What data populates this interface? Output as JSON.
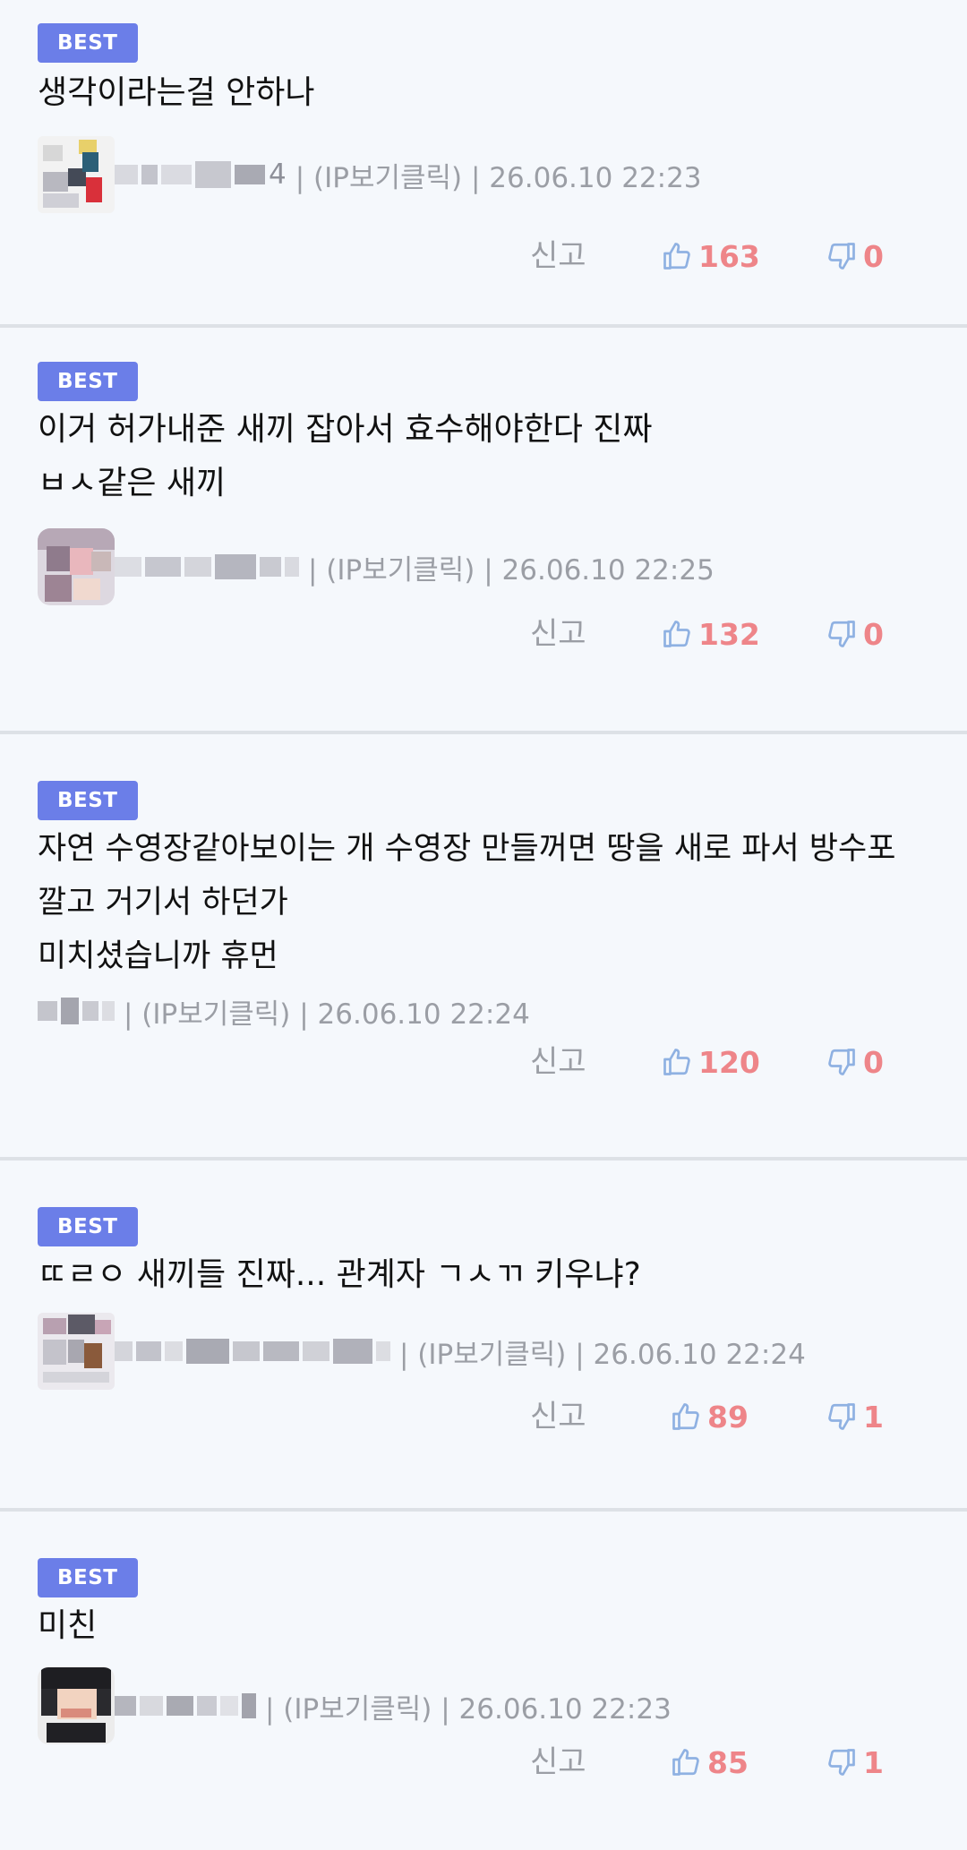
{
  "comments": [
    {
      "badge": "BEST",
      "content": "생각이라는걸 안하나",
      "nick_tail": "4",
      "meta": "| (IP보기클릭) | 26.06.10 22:23",
      "report_label": "신고",
      "likes": "163",
      "dislikes": "0"
    },
    {
      "badge": "BEST",
      "content": "이거 허가내준 새끼 잡아서 효수해야한다 진짜\nㅂㅅ같은 새끼",
      "nick_tail": "",
      "meta": "| (IP보기클릭) | 26.06.10 22:25",
      "report_label": "신고",
      "likes": "132",
      "dislikes": "0"
    },
    {
      "badge": "BEST",
      "content": "자연 수영장같아보이는 개 수영장 만들꺼면 땅을 새로 파서 방수포 깔고 거기서 하던가\n미치셨습니까 휴먼",
      "nick_tail": "",
      "meta": "| (IP보기클릭) | 26.06.10 22:24",
      "report_label": "신고",
      "likes": "120",
      "dislikes": "0"
    },
    {
      "badge": "BEST",
      "content": "ㄸㄹㅇ 새끼들 진짜... 관계자 ㄱㅅㄲ 키우냐?",
      "nick_tail": "",
      "meta": "| (IP보기클릭) | 26.06.10 22:24",
      "report_label": "신고",
      "likes": "89",
      "dislikes": "1"
    },
    {
      "badge": "BEST",
      "content": "미친",
      "nick_tail": "",
      "meta": "| (IP보기클릭) | 26.06.10 22:23",
      "report_label": "신고",
      "likes": "85",
      "dislikes": "1"
    }
  ],
  "colors": {
    "badge_bg": "#6b7ee8",
    "like_count": "#ee8589",
    "thumb_icon": "#8fb1e2",
    "meta_text": "#9b9ea5"
  },
  "icons": {
    "like": "thumbs-up-icon",
    "dislike": "thumbs-down-icon"
  }
}
